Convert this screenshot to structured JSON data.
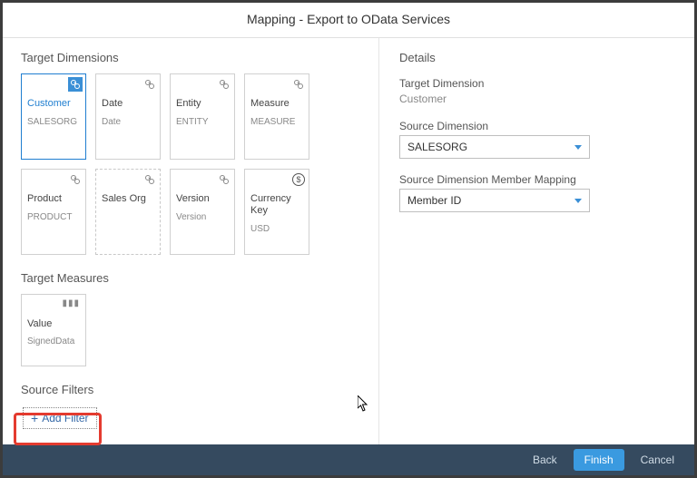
{
  "dialog": {
    "title": "Mapping - Export to OData Services"
  },
  "left": {
    "targetDimensionsTitle": "Target Dimensions",
    "cards": [
      {
        "title": "Customer",
        "sub": "SALESORG"
      },
      {
        "title": "Date",
        "sub": "Date"
      },
      {
        "title": "Entity",
        "sub": "ENTITY"
      },
      {
        "title": "Measure",
        "sub": "MEASURE"
      },
      {
        "title": "Product",
        "sub": "PRODUCT"
      },
      {
        "title": "Sales Org",
        "sub": ""
      },
      {
        "title": "Version",
        "sub": "Version"
      },
      {
        "title": "Currency Key",
        "sub": "USD"
      }
    ],
    "targetMeasuresTitle": "Target Measures",
    "measure": {
      "title": "Value",
      "sub": "SignedData"
    },
    "sourceFiltersTitle": "Source Filters",
    "addFilterLabel": "Add Filter"
  },
  "right": {
    "detailsTitle": "Details",
    "targetDimLabel": "Target Dimension",
    "targetDimValue": "Customer",
    "sourceDimLabel": "Source Dimension",
    "sourceDimValue": "SALESORG",
    "memberMappingLabel": "Source Dimension Member Mapping",
    "memberMappingValue": "Member ID"
  },
  "footer": {
    "back": "Back",
    "finish": "Finish",
    "cancel": "Cancel"
  }
}
